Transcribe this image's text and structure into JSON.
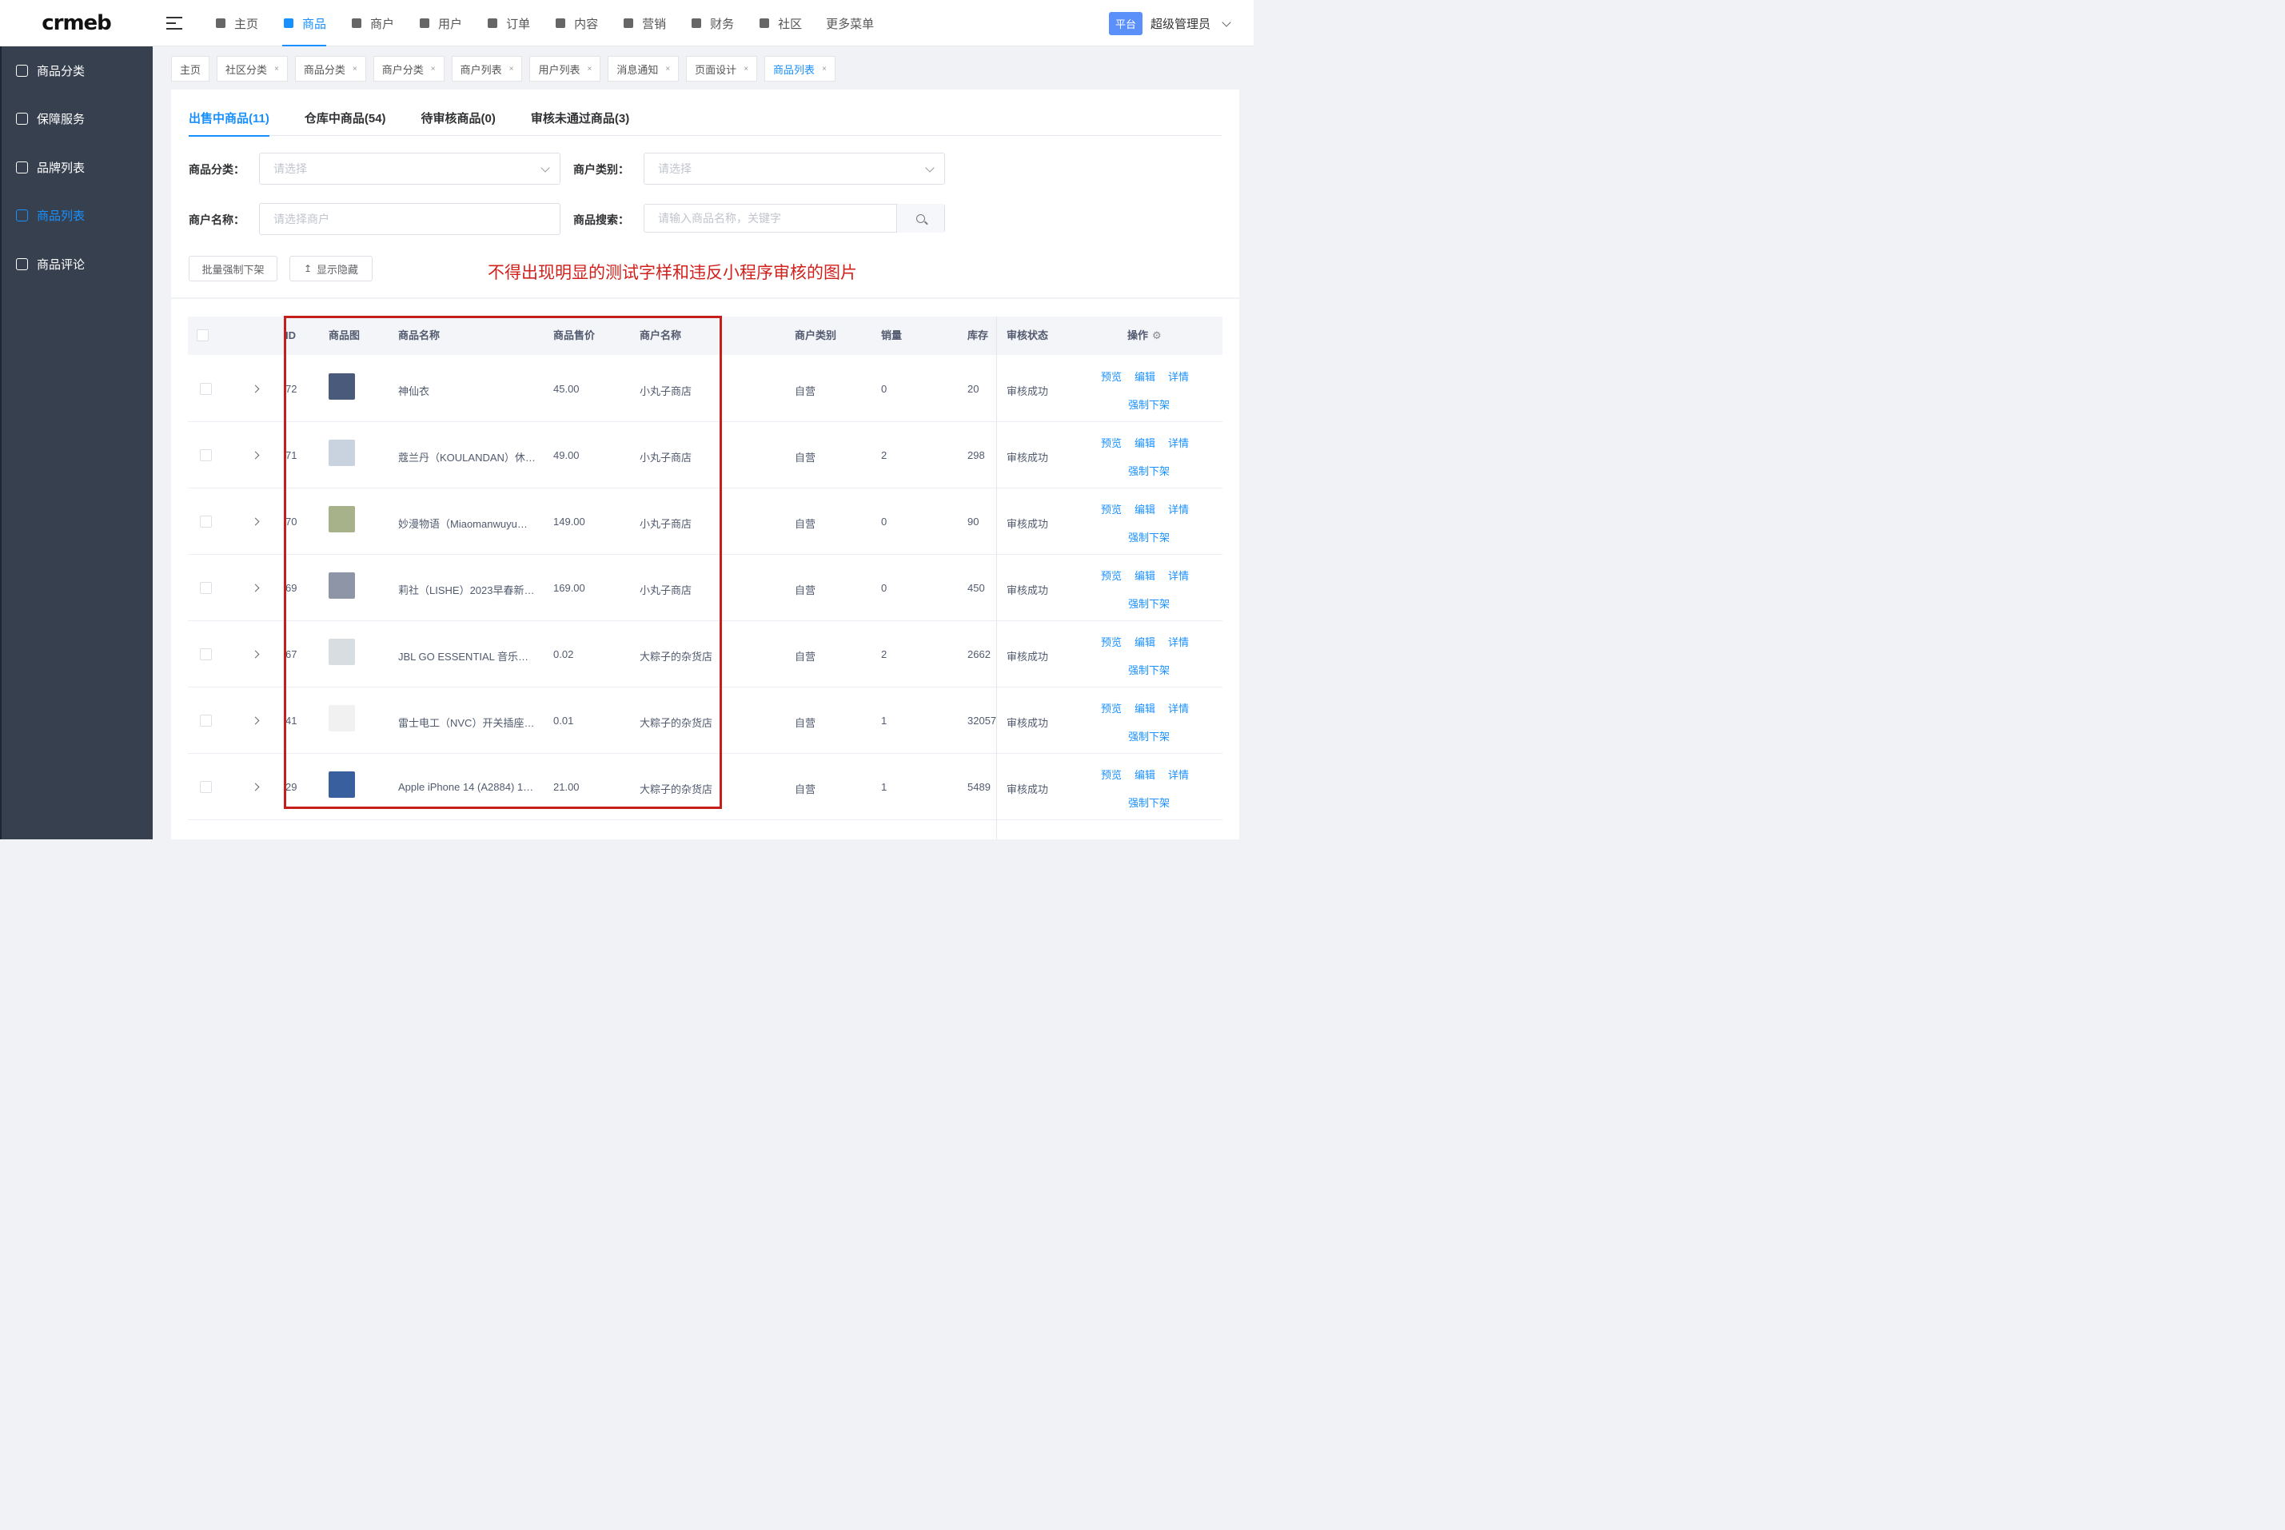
{
  "brand": {
    "logo_text": "crmeb"
  },
  "top_nav": [
    {
      "label": "主页",
      "icon": "grid-icon",
      "active": false
    },
    {
      "label": "商品",
      "icon": "bag-icon",
      "active": true
    },
    {
      "label": "商户",
      "icon": "store-icon",
      "active": false
    },
    {
      "label": "用户",
      "icon": "user-icon",
      "active": false
    },
    {
      "label": "订单",
      "icon": "clipboard-icon",
      "active": false
    },
    {
      "label": "内容",
      "icon": "book-icon",
      "active": false
    },
    {
      "label": "营销",
      "icon": "chart-icon",
      "active": false
    },
    {
      "label": "财务",
      "icon": "wallet-icon",
      "active": false
    },
    {
      "label": "社区",
      "icon": "table-icon",
      "active": false
    },
    {
      "label": "更多菜单",
      "icon": "",
      "active": false
    }
  ],
  "header": {
    "platform_badge": "平台",
    "admin_name": "超级管理员"
  },
  "sidebar": {
    "items": [
      {
        "label": "商品分类",
        "icon": "tag-icon",
        "active": false
      },
      {
        "label": "保障服务",
        "icon": "rocket-icon",
        "active": false
      },
      {
        "label": "品牌列表",
        "icon": "label-icon",
        "active": false
      },
      {
        "label": "商品列表",
        "icon": "search-list-icon",
        "active": true
      },
      {
        "label": "商品评论",
        "icon": "comment-icon",
        "active": false
      }
    ]
  },
  "tags": [
    {
      "label": "主页",
      "closable": false,
      "active": false
    },
    {
      "label": "社区分类",
      "closable": true,
      "active": false
    },
    {
      "label": "商品分类",
      "closable": true,
      "active": false
    },
    {
      "label": "商户分类",
      "closable": true,
      "active": false
    },
    {
      "label": "商户列表",
      "closable": true,
      "active": false
    },
    {
      "label": "用户列表",
      "closable": true,
      "active": false
    },
    {
      "label": "消息通知",
      "closable": true,
      "active": false
    },
    {
      "label": "页面设计",
      "closable": true,
      "active": false
    },
    {
      "label": "商品列表",
      "closable": true,
      "active": true
    }
  ],
  "tabs": [
    {
      "label": "出售中商品(11)",
      "active": true
    },
    {
      "label": "仓库中商品(54)",
      "active": false
    },
    {
      "label": "待审核商品(0)",
      "active": false
    },
    {
      "label": "审核未通过商品(3)",
      "active": false
    }
  ],
  "filters": {
    "category_label": "商品分类：",
    "category_placeholder": "请选择",
    "merchant_type_label": "商户类别：",
    "merchant_type_placeholder": "请选择",
    "merchant_name_label": "商户名称：",
    "merchant_name_placeholder": "请选择商户",
    "search_label": "商品搜索：",
    "search_placeholder": "请输入商品名称，关键字"
  },
  "actions": {
    "batch_off": "批量强制下架",
    "show_hidden": "显示隐藏"
  },
  "notice": "不得出现明显的测试字样和违反小程序审核的图片",
  "table": {
    "headers": {
      "id": "ID",
      "image": "商品图",
      "name": "商品名称",
      "price": "商品售价",
      "merchant": "商户名称",
      "merchant_type": "商户类别",
      "sales": "销量",
      "stock": "库存",
      "status": "审核状态",
      "ops": "操作"
    },
    "ops": {
      "preview": "预览",
      "edit": "编辑",
      "detail": "详情",
      "force_off": "强制下架"
    },
    "rows": [
      {
        "id": "72",
        "name": "神仙衣",
        "price": "45.00",
        "merchant": "小丸子商店",
        "merchant_type": "自营",
        "sales": "0",
        "stock": "20",
        "status": "审核成功",
        "thumb_color": "#4a5a7a"
      },
      {
        "id": "71",
        "name": "蔻兰丹（KOULANDAN）休…",
        "price": "49.00",
        "merchant": "小丸子商店",
        "merchant_type": "自营",
        "sales": "2",
        "stock": "298",
        "status": "审核成功",
        "thumb_color": "#c9d3e0"
      },
      {
        "id": "70",
        "name": "妙漫物语（Miaomanwuyu…",
        "price": "149.00",
        "merchant": "小丸子商店",
        "merchant_type": "自营",
        "sales": "0",
        "stock": "90",
        "status": "审核成功",
        "thumb_color": "#a7b28a"
      },
      {
        "id": "69",
        "name": "莉社（LISHE）2023早春新…",
        "price": "169.00",
        "merchant": "小丸子商店",
        "merchant_type": "自营",
        "sales": "0",
        "stock": "450",
        "status": "审核成功",
        "thumb_color": "#8d95a6"
      },
      {
        "id": "67",
        "name": "JBL GO ESSENTIAL 音乐…",
        "price": "0.02",
        "merchant": "大粽子的杂货店",
        "merchant_type": "自营",
        "sales": "2",
        "stock": "2662",
        "status": "审核成功",
        "thumb_color": "#d8dde2"
      },
      {
        "id": "41",
        "name": "雷士电工（NVC）开关插座…",
        "price": "0.01",
        "merchant": "大粽子的杂货店",
        "merchant_type": "自营",
        "sales": "1",
        "stock": "32057",
        "status": "审核成功",
        "thumb_color": "#f1f1f1"
      },
      {
        "id": "29",
        "name": "Apple iPhone 14 (A2884) 1…",
        "price": "21.00",
        "merchant": "大粽子的杂货店",
        "merchant_type": "自营",
        "sales": "1",
        "stock": "5489",
        "status": "审核成功",
        "thumb_color": "#3a5f9e"
      }
    ]
  },
  "colors": {
    "accent": "#1890ff",
    "sidebar_bg": "#36404f",
    "annotation_red": "#c41f1a",
    "notice_red": "#d0211c"
  }
}
